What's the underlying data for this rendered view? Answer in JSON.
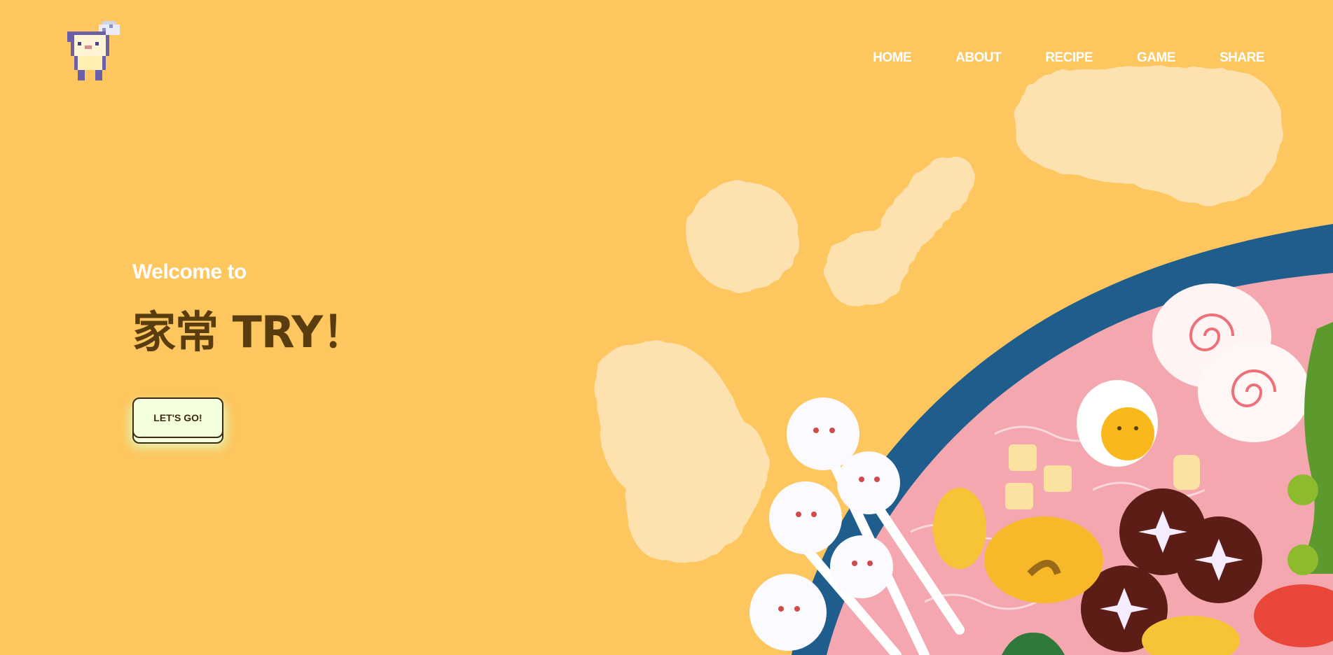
{
  "brand": {
    "logo_icon": "pixel-mouse-chef-icon"
  },
  "nav": {
    "items": [
      {
        "label": "HOME"
      },
      {
        "label": "ABOUT"
      },
      {
        "label": "RECIPE"
      },
      {
        "label": "GAME"
      },
      {
        "label": "SHARE"
      }
    ]
  },
  "hero": {
    "welcome": "Welcome to",
    "title": "家常 TRY！",
    "cta_label": "LET'S GO!"
  },
  "colors": {
    "background": "#fdc65e",
    "nav_text": "#ffffff",
    "title": "#5a3d0e",
    "button_bg": "#f4ffe0",
    "bowl_rim": "#1f5e8c",
    "broth": "#f4a7ae"
  }
}
